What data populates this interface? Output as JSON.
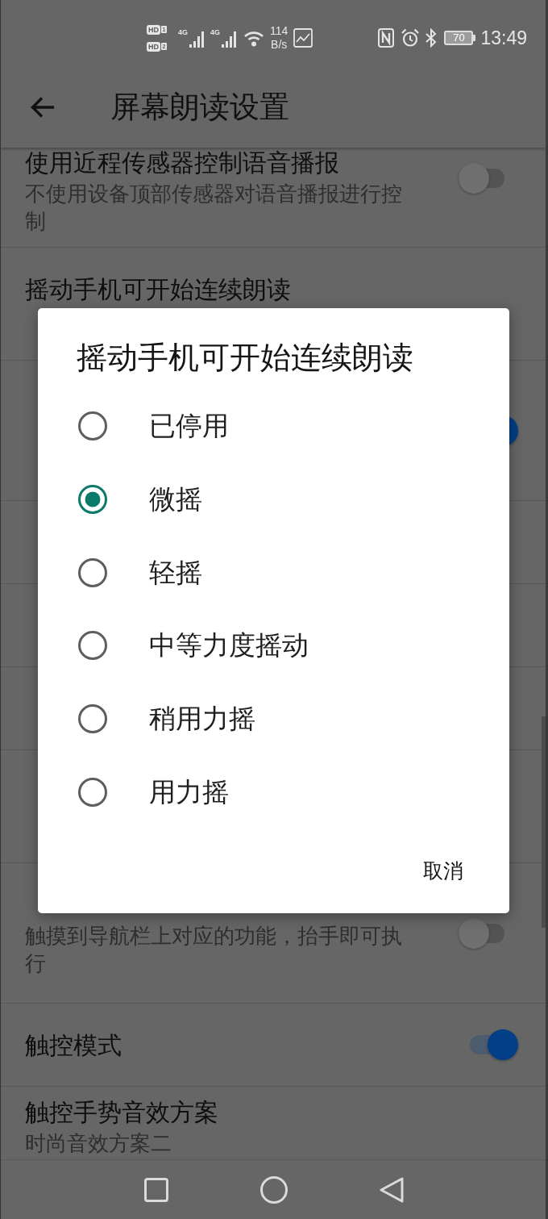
{
  "status_bar": {
    "sim_badges": [
      {
        "label": "HD",
        "slot": "1"
      },
      {
        "label": "HD",
        "slot": "2"
      }
    ],
    "networks": [
      {
        "type": "4G"
      },
      {
        "type": "4G"
      }
    ],
    "net_speed": {
      "value": "114",
      "unit": "B/s"
    },
    "battery": "70",
    "time": "13:49"
  },
  "app_bar": {
    "title": "屏幕朗读设置"
  },
  "settings": [
    {
      "kind": "toggle_summary",
      "title": "使用近程传感器控制语音播报",
      "description": "不使用设备顶部传感器对语音播报进行控制",
      "on": false
    },
    {
      "kind": "summary",
      "title": "摇动手机可开始连续朗读"
    },
    {
      "kind": "toggle_summary",
      "on": true
    },
    {
      "kind": "plain"
    },
    {
      "kind": "plain"
    },
    {
      "kind": "plain"
    },
    {
      "kind": "summary"
    },
    {
      "kind": "toggle_summary",
      "description": "触摸到导航栏上对应的功能，抬手即可执行",
      "on": false
    },
    {
      "kind": "toggle",
      "title": "触控模式",
      "on": true
    },
    {
      "kind": "summary",
      "title": "触控手势音效方案",
      "description": "时尚音效方案二"
    }
  ],
  "dialog": {
    "title": "摇动手机可开始连续朗读",
    "options": [
      {
        "label": "已停用",
        "selected": false
      },
      {
        "label": "微摇",
        "selected": true
      },
      {
        "label": "轻摇",
        "selected": false
      },
      {
        "label": "中等力度摇动",
        "selected": false
      },
      {
        "label": "稍用力摇",
        "selected": false
      },
      {
        "label": "用力摇",
        "selected": false
      }
    ],
    "buttons": [
      {
        "label": "取消"
      }
    ]
  }
}
